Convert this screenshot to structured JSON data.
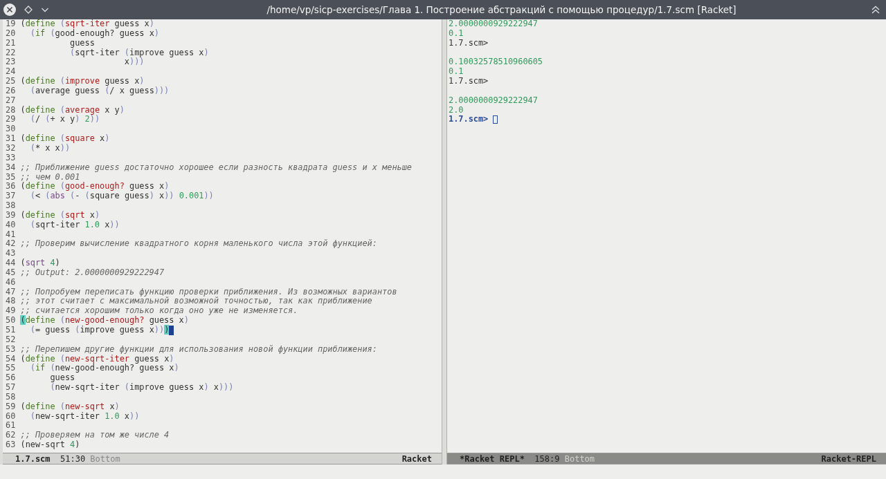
{
  "window": {
    "title": "/home/vp/sicp-exercises/Глава 1. Построение абстракций с помощью процедур/1.7.scm [Racket]"
  },
  "editor": {
    "lines": [
      {
        "number": "19",
        "tokens": [
          {
            "kind": "plain",
            "text": "("
          },
          {
            "kind": "kw",
            "text": "define "
          },
          {
            "kind": "paren",
            "text": "("
          },
          {
            "kind": "fn",
            "text": "sqrt-iter"
          },
          {
            "kind": "plain",
            "text": " guess x"
          },
          {
            "kind": "paren",
            "text": ")"
          }
        ]
      },
      {
        "number": "20",
        "tokens": [
          {
            "kind": "paren",
            "text": "  ("
          },
          {
            "kind": "kw",
            "text": "if "
          },
          {
            "kind": "paren",
            "text": "("
          },
          {
            "kind": "plain",
            "text": "good-enough? guess x"
          },
          {
            "kind": "paren",
            "text": ")"
          }
        ]
      },
      {
        "number": "21",
        "tokens": [
          {
            "kind": "plain",
            "text": "          guess"
          }
        ]
      },
      {
        "number": "22",
        "tokens": [
          {
            "kind": "paren",
            "text": "          ("
          },
          {
            "kind": "plain",
            "text": "sqrt-iter "
          },
          {
            "kind": "paren",
            "text": "("
          },
          {
            "kind": "plain",
            "text": "improve guess x"
          },
          {
            "kind": "paren",
            "text": ")"
          }
        ]
      },
      {
        "number": "23",
        "tokens": [
          {
            "kind": "plain",
            "text": "                     x"
          },
          {
            "kind": "paren",
            "text": ")))"
          }
        ]
      },
      {
        "number": "24"
      },
      {
        "number": "25",
        "tokens": [
          {
            "kind": "plain",
            "text": "("
          },
          {
            "kind": "kw",
            "text": "define "
          },
          {
            "kind": "paren",
            "text": "("
          },
          {
            "kind": "fn",
            "text": "improve"
          },
          {
            "kind": "plain",
            "text": " guess x"
          },
          {
            "kind": "paren",
            "text": ")"
          }
        ]
      },
      {
        "number": "26",
        "tokens": [
          {
            "kind": "paren",
            "text": "  ("
          },
          {
            "kind": "plain",
            "text": "average guess "
          },
          {
            "kind": "paren",
            "text": "("
          },
          {
            "kind": "plain",
            "text": "/ x guess"
          },
          {
            "kind": "paren",
            "text": ")))"
          }
        ]
      },
      {
        "number": "27"
      },
      {
        "number": "28",
        "tokens": [
          {
            "kind": "plain",
            "text": "("
          },
          {
            "kind": "kw",
            "text": "define "
          },
          {
            "kind": "paren",
            "text": "("
          },
          {
            "kind": "fn",
            "text": "average"
          },
          {
            "kind": "plain",
            "text": " x y"
          },
          {
            "kind": "paren",
            "text": ")"
          }
        ]
      },
      {
        "number": "29",
        "tokens": [
          {
            "kind": "paren",
            "text": "  ("
          },
          {
            "kind": "plain",
            "text": "/ "
          },
          {
            "kind": "paren",
            "text": "("
          },
          {
            "kind": "plain",
            "text": "+ x y"
          },
          {
            "kind": "paren",
            "text": ") "
          },
          {
            "kind": "num",
            "text": "2"
          },
          {
            "kind": "paren",
            "text": "))"
          }
        ]
      },
      {
        "number": "30"
      },
      {
        "number": "31",
        "tokens": [
          {
            "kind": "plain",
            "text": "("
          },
          {
            "kind": "kw",
            "text": "define "
          },
          {
            "kind": "paren",
            "text": "("
          },
          {
            "kind": "fn",
            "text": "square"
          },
          {
            "kind": "plain",
            "text": " x"
          },
          {
            "kind": "paren",
            "text": ")"
          }
        ]
      },
      {
        "number": "32",
        "tokens": [
          {
            "kind": "paren",
            "text": "  ("
          },
          {
            "kind": "plain",
            "text": "* x x"
          },
          {
            "kind": "paren",
            "text": "))"
          }
        ]
      },
      {
        "number": "33"
      },
      {
        "number": "34",
        "tokens": [
          {
            "kind": "comment",
            "text": ";; Приближение guess достаточно хорошее если разность квадрата guess и x меньше"
          }
        ]
      },
      {
        "number": "35",
        "tokens": [
          {
            "kind": "comment",
            "text": ";; чем 0.001"
          }
        ]
      },
      {
        "number": "36",
        "tokens": [
          {
            "kind": "plain",
            "text": "("
          },
          {
            "kind": "kw",
            "text": "define "
          },
          {
            "kind": "paren",
            "text": "("
          },
          {
            "kind": "fn",
            "text": "good-enough?"
          },
          {
            "kind": "plain",
            "text": " guess x"
          },
          {
            "kind": "paren",
            "text": ")"
          }
        ]
      },
      {
        "number": "37",
        "tokens": [
          {
            "kind": "paren",
            "text": "  ("
          },
          {
            "kind": "plain",
            "text": "< "
          },
          {
            "kind": "paren",
            "text": "("
          },
          {
            "kind": "builtin",
            "text": "abs "
          },
          {
            "kind": "paren",
            "text": "("
          },
          {
            "kind": "plain",
            "text": "- "
          },
          {
            "kind": "paren",
            "text": "("
          },
          {
            "kind": "plain",
            "text": "square guess"
          },
          {
            "kind": "paren",
            "text": ")"
          },
          {
            "kind": "plain",
            "text": " x"
          },
          {
            "kind": "paren",
            "text": ")) "
          },
          {
            "kind": "num",
            "text": "0.001"
          },
          {
            "kind": "paren",
            "text": "))"
          }
        ]
      },
      {
        "number": "38"
      },
      {
        "number": "39",
        "tokens": [
          {
            "kind": "plain",
            "text": "("
          },
          {
            "kind": "kw",
            "text": "define "
          },
          {
            "kind": "paren",
            "text": "("
          },
          {
            "kind": "fn",
            "text": "sqrt"
          },
          {
            "kind": "plain",
            "text": " x"
          },
          {
            "kind": "paren",
            "text": ")"
          }
        ]
      },
      {
        "number": "40",
        "tokens": [
          {
            "kind": "paren",
            "text": "  ("
          },
          {
            "kind": "plain",
            "text": "sqrt-iter "
          },
          {
            "kind": "num",
            "text": "1.0"
          },
          {
            "kind": "plain",
            "text": " x"
          },
          {
            "kind": "paren",
            "text": "))"
          }
        ]
      },
      {
        "number": "41"
      },
      {
        "number": "42",
        "tokens": [
          {
            "kind": "comment",
            "text": ";; Проверим вычисление квадратного корня маленького числа этой функцией:"
          }
        ]
      },
      {
        "number": "43"
      },
      {
        "number": "44",
        "tokens": [
          {
            "kind": "plain",
            "text": "("
          },
          {
            "kind": "builtin",
            "text": "sqrt "
          },
          {
            "kind": "num",
            "text": "4"
          },
          {
            "kind": "plain",
            "text": ")"
          }
        ]
      },
      {
        "number": "45",
        "tokens": [
          {
            "kind": "comment",
            "text": ";; Output: 2.0000000929222947"
          }
        ]
      },
      {
        "number": "46"
      },
      {
        "number": "47",
        "tokens": [
          {
            "kind": "comment",
            "text": ";; Попробуем переписать функцию проверки приближения. Из возможных вариантов"
          }
        ]
      },
      {
        "number": "48",
        "tokens": [
          {
            "kind": "comment",
            "text": ";; этот считает с максимальной возможной точностью, так как приближение"
          }
        ]
      },
      {
        "number": "49",
        "tokens": [
          {
            "kind": "comment",
            "text": ";; считается хорошим только когда оно уже не изменяется."
          }
        ]
      },
      {
        "number": "50",
        "tokens": [
          {
            "kind": "match",
            "text": "("
          },
          {
            "kind": "kw",
            "text": "define "
          },
          {
            "kind": "paren",
            "text": "("
          },
          {
            "kind": "fn",
            "text": "new-good-enough?"
          },
          {
            "kind": "plain",
            "text": " guess x"
          },
          {
            "kind": "paren",
            "text": ")"
          }
        ]
      },
      {
        "number": "51",
        "cursor": true,
        "tokens": [
          {
            "kind": "paren",
            "text": "  ("
          },
          {
            "kind": "plain",
            "text": "= guess "
          },
          {
            "kind": "paren",
            "text": "("
          },
          {
            "kind": "plain",
            "text": "improve guess x"
          },
          {
            "kind": "paren",
            "text": "))"
          },
          {
            "kind": "match",
            "text": ")"
          }
        ]
      },
      {
        "number": "52"
      },
      {
        "number": "53",
        "tokens": [
          {
            "kind": "comment",
            "text": ";; Перепишем другие функции для использования новой функции приближения:"
          }
        ]
      },
      {
        "number": "54",
        "tokens": [
          {
            "kind": "plain",
            "text": "("
          },
          {
            "kind": "kw",
            "text": "define "
          },
          {
            "kind": "paren",
            "text": "("
          },
          {
            "kind": "fn",
            "text": "new-sqrt-iter"
          },
          {
            "kind": "plain",
            "text": " guess x"
          },
          {
            "kind": "paren",
            "text": ")"
          }
        ]
      },
      {
        "number": "55",
        "tokens": [
          {
            "kind": "paren",
            "text": "  ("
          },
          {
            "kind": "kw",
            "text": "if "
          },
          {
            "kind": "paren",
            "text": "("
          },
          {
            "kind": "plain",
            "text": "new-good-enough? guess x"
          },
          {
            "kind": "paren",
            "text": ")"
          }
        ]
      },
      {
        "number": "56",
        "tokens": [
          {
            "kind": "plain",
            "text": "      guess"
          }
        ]
      },
      {
        "number": "57",
        "tokens": [
          {
            "kind": "paren",
            "text": "      ("
          },
          {
            "kind": "plain",
            "text": "new-sqrt-iter "
          },
          {
            "kind": "paren",
            "text": "("
          },
          {
            "kind": "plain",
            "text": "improve guess x"
          },
          {
            "kind": "paren",
            "text": ")"
          },
          {
            "kind": "plain",
            "text": " x"
          },
          {
            "kind": "paren",
            "text": ")))"
          }
        ]
      },
      {
        "number": "58"
      },
      {
        "number": "59",
        "tokens": [
          {
            "kind": "plain",
            "text": "("
          },
          {
            "kind": "kw",
            "text": "define "
          },
          {
            "kind": "paren",
            "text": "("
          },
          {
            "kind": "fn",
            "text": "new-sqrt"
          },
          {
            "kind": "plain",
            "text": " x"
          },
          {
            "kind": "paren",
            "text": ")"
          }
        ]
      },
      {
        "number": "60",
        "tokens": [
          {
            "kind": "paren",
            "text": "  ("
          },
          {
            "kind": "plain",
            "text": "new-sqrt-iter "
          },
          {
            "kind": "num",
            "text": "1.0"
          },
          {
            "kind": "plain",
            "text": " x"
          },
          {
            "kind": "paren",
            "text": "))"
          }
        ]
      },
      {
        "number": "61"
      },
      {
        "number": "62",
        "tokens": [
          {
            "kind": "comment",
            "text": ";; Проверяем на том же числе 4"
          }
        ]
      },
      {
        "number": "63",
        "tokens": [
          {
            "kind": "plain",
            "text": "(new-sqrt "
          },
          {
            "kind": "num",
            "text": "4"
          },
          {
            "kind": "plain",
            "text": ")"
          }
        ]
      }
    ],
    "mode_line": {
      "buffer": "1.7.scm",
      "position": "51:30",
      "scroll": "Bottom",
      "mode": "Racket",
      "active": true
    }
  },
  "repl": {
    "lines": [
      {
        "kind": "value",
        "text": "2.0000000929222947"
      },
      {
        "kind": "value",
        "text": "0.1"
      },
      {
        "kind": "prompt",
        "text": "1.7.scm>"
      },
      {
        "kind": "blank"
      },
      {
        "kind": "value",
        "text": "0.10032578510960605"
      },
      {
        "kind": "value",
        "text": "0.1"
      },
      {
        "kind": "prompt",
        "text": "1.7.scm>"
      },
      {
        "kind": "blank"
      },
      {
        "kind": "value",
        "text": "2.0000000929222947"
      },
      {
        "kind": "value",
        "text": "2.0"
      },
      {
        "kind": "active_prompt",
        "text": "1.7.scm>"
      }
    ],
    "mode_line": {
      "buffer": "*Racket REPL*",
      "position": "158:9",
      "scroll": "Bottom",
      "mode": "Racket-REPL",
      "active": false
    }
  }
}
